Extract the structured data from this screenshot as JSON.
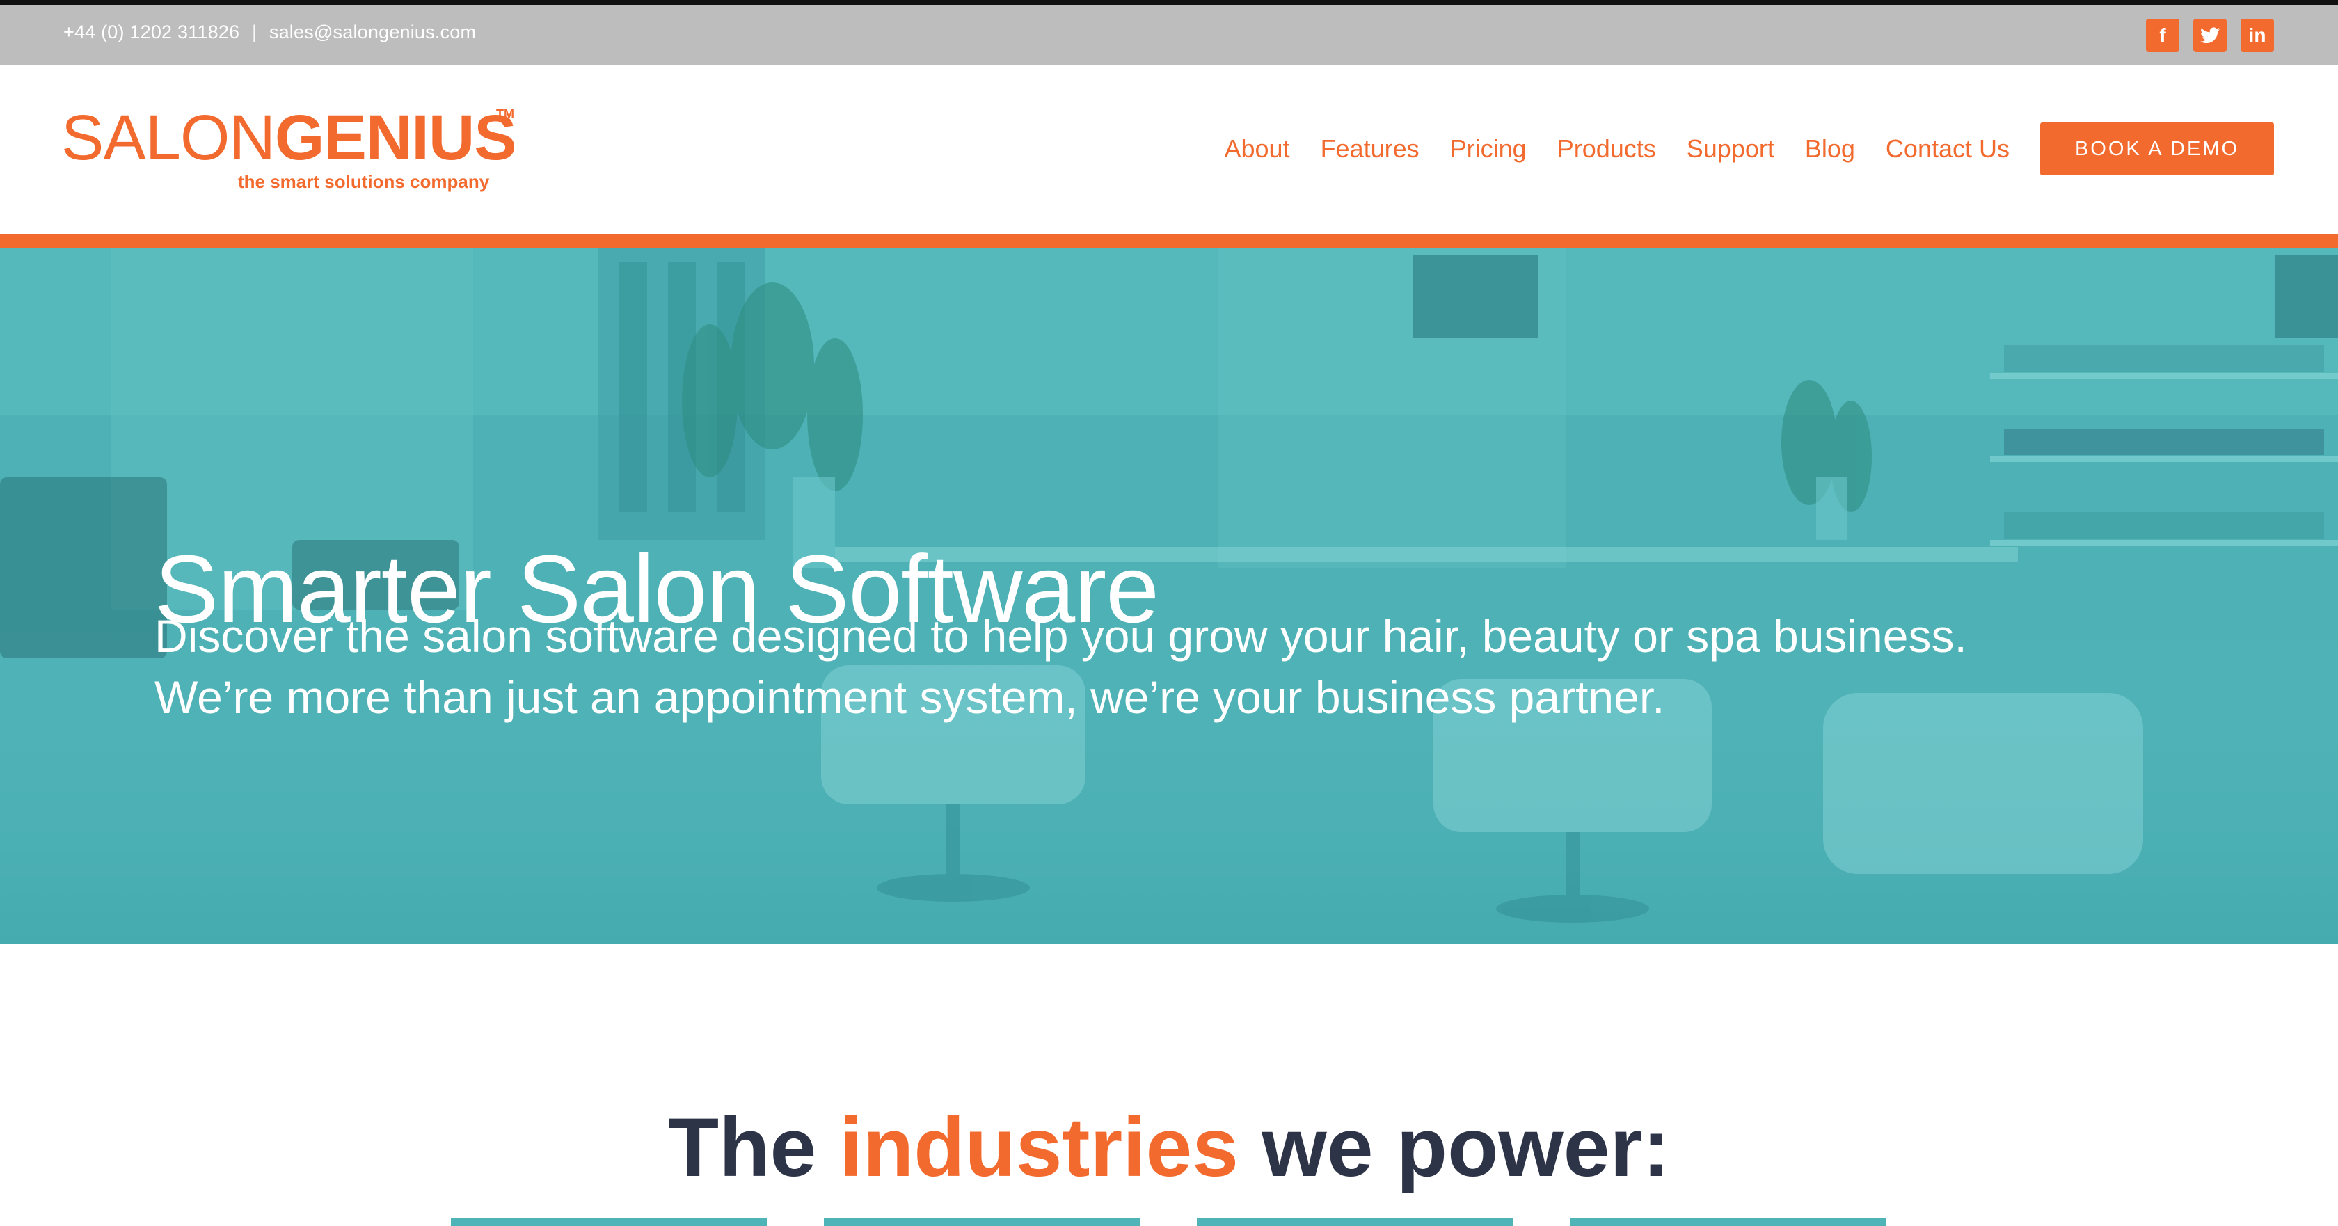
{
  "topbar": {
    "phone": "+44 (0) 1202 311826",
    "separator": "|",
    "email": "sales@salongenius.com",
    "social": [
      {
        "name": "facebook-icon",
        "glyph": "f"
      },
      {
        "name": "twitter-icon",
        "glyph": "t"
      },
      {
        "name": "linkedin-icon",
        "glyph": "in"
      }
    ]
  },
  "logo": {
    "light": "SALON",
    "bold": "GENIUS",
    "tm": "TM",
    "tagline": "the smart solutions company"
  },
  "nav": {
    "items": [
      "About",
      "Features",
      "Pricing",
      "Products",
      "Support",
      "Blog",
      "Contact Us"
    ],
    "cta": "BOOK A DEMO"
  },
  "hero": {
    "title": "Smarter Salon Software",
    "subtitle_line1": "Discover the salon software designed to help you grow your hair, beauty or spa business.",
    "subtitle_line2": "We’re more than just an appointment system, we’re your business partner."
  },
  "industries": {
    "prefix": "The",
    "accent": "industries",
    "suffix": "we power:"
  },
  "colors": {
    "accent": "#f26a2e",
    "teal": "#4fb4b8",
    "topbar": "#bdbdbd",
    "heading": "#2e3447"
  }
}
